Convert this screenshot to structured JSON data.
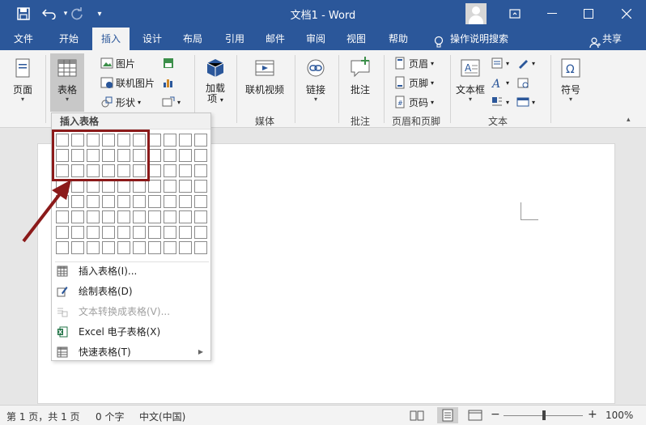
{
  "titlebar": {
    "title": "文档1  -  Word",
    "save_icon": "save-icon",
    "undo_icon": "undo-icon",
    "redo_icon": "redo-icon"
  },
  "tabs": [
    {
      "label": "文件"
    },
    {
      "label": "开始"
    },
    {
      "label": "插入",
      "active": true
    },
    {
      "label": "设计"
    },
    {
      "label": "布局"
    },
    {
      "label": "引用"
    },
    {
      "label": "邮件"
    },
    {
      "label": "审阅"
    },
    {
      "label": "视图"
    },
    {
      "label": "帮助"
    }
  ],
  "tell_me": "操作说明搜索",
  "share": "共享",
  "ribbon": {
    "page": "页面",
    "table": "表格",
    "picture": "图片",
    "online_picture": "联机图片",
    "shapes": "形状",
    "addins": "加载\n项",
    "online_video": "联机视频",
    "link": "链接",
    "comment": "批注",
    "header": "页眉",
    "footer": "页脚",
    "page_number": "页码",
    "textbox": "文本框",
    "symbol": "符号",
    "group_media": "媒体",
    "group_comment": "批注",
    "group_header_footer": "页眉和页脚",
    "group_text": "文本"
  },
  "menu": {
    "header": "插入表格",
    "grid_cols": 10,
    "grid_rows": 8,
    "highlight_cols": 6,
    "highlight_rows": 3,
    "items": [
      {
        "label": "插入表格(I)...",
        "enabled": true
      },
      {
        "label": "绘制表格(D)",
        "enabled": true
      },
      {
        "label": "文本转换成表格(V)...",
        "enabled": false
      },
      {
        "label": "Excel 电子表格(X)",
        "enabled": true
      },
      {
        "label": "快速表格(T)",
        "enabled": true,
        "submenu": true
      }
    ]
  },
  "status": {
    "page": "第 1 页，共 1 页",
    "words": "0 个字",
    "language": "中文(中国)",
    "zoom": "100%"
  },
  "colors": {
    "accent": "#2b579a",
    "highlight": "#8b1a1a"
  }
}
